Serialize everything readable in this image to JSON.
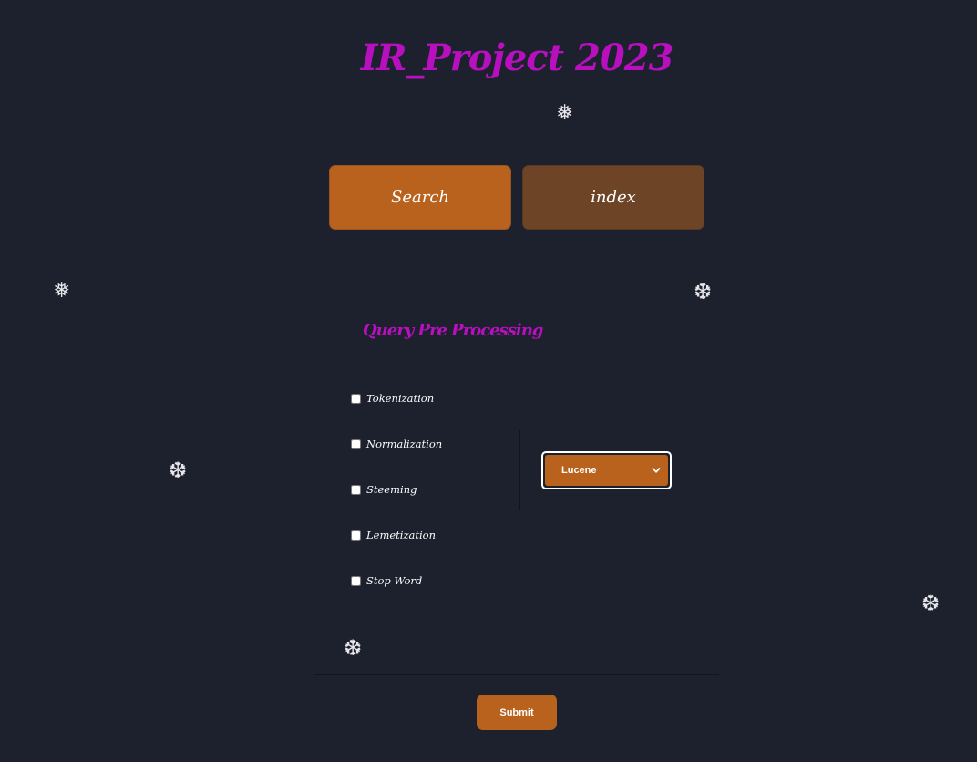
{
  "header": {
    "title": "IR_Project 2023"
  },
  "tabs": [
    {
      "label": "Search"
    },
    {
      "label": "index"
    }
  ],
  "query_panel": {
    "title": "Query Pre Processing",
    "options": [
      {
        "label": "Tokenization",
        "checked": false
      },
      {
        "label": "Normalization",
        "checked": false
      },
      {
        "label": "Steeming",
        "checked": false
      },
      {
        "label": "Lemetization",
        "checked": false
      },
      {
        "label": "Stop Word",
        "checked": false
      }
    ],
    "engine_select": {
      "selected": "Lucene"
    }
  },
  "submit": {
    "label": "Submit"
  },
  "snowflakes": [
    {
      "glyph": "❅",
      "icon": "snowflake-icon"
    },
    {
      "glyph": "❅",
      "icon": "snowflake-icon"
    },
    {
      "glyph": "❆",
      "icon": "snowflake-icon"
    },
    {
      "glyph": "❆",
      "icon": "snowflake-icon"
    },
    {
      "glyph": "❆",
      "icon": "snowflake-icon"
    },
    {
      "glyph": "❆",
      "icon": "snowflake-icon"
    }
  ],
  "colors": {
    "background": "#1d212e",
    "accent_magenta": "#b80fbf",
    "accent_orange": "#b8621d",
    "tab_inactive": "#6d4526"
  }
}
